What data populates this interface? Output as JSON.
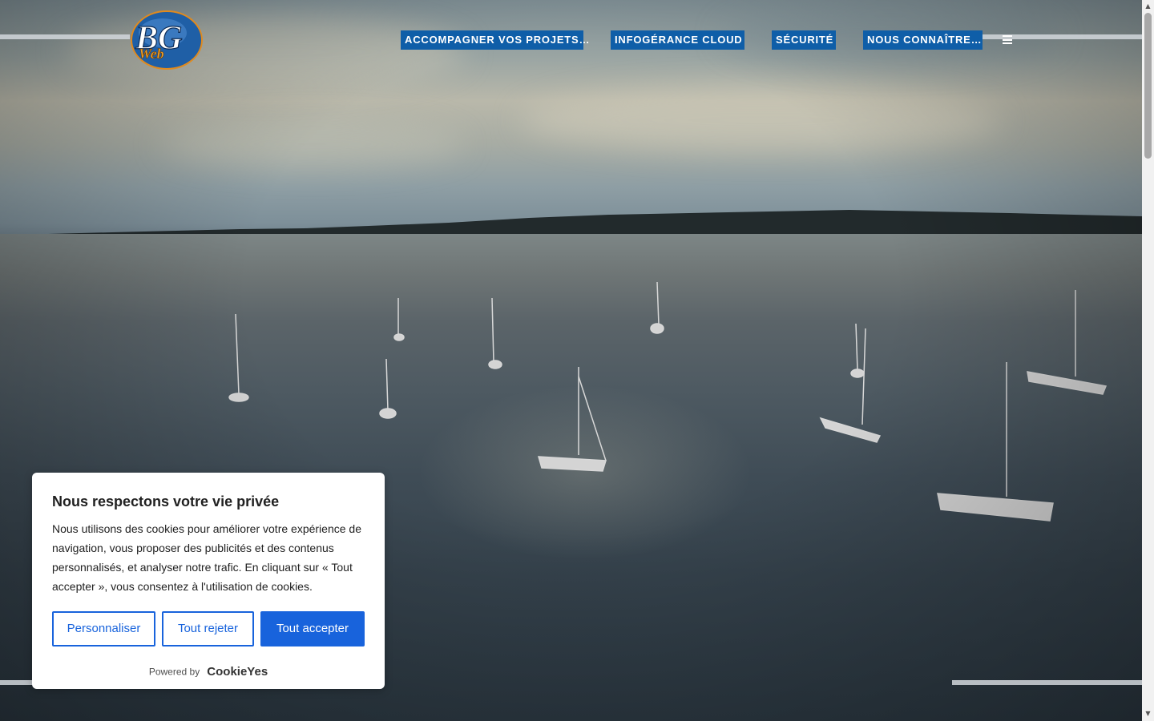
{
  "logo": {
    "line1": "BG",
    "line2": "Web"
  },
  "nav": {
    "items": [
      {
        "label": "ACCOMPAGNER VOS PROJETS…"
      },
      {
        "label": "INFOGÉRANCE CLOUD"
      },
      {
        "label": "SÉCURITÉ"
      },
      {
        "label": "NOUS CONNAÎTRE…"
      }
    ],
    "menu_icon": "hamburger-icon"
  },
  "hero": {
    "image": "aerial view of sailboats anchored on a lake at dusk"
  },
  "cookie_banner": {
    "title": "Nous respectons votre vie privée",
    "text": "Nous utilisons des cookies pour améliorer votre expérience de navigation, vous proposer des publicités et des contenus personnalisés, et analyser notre trafic. En cliquant sur « Tout accepter », vous consentez à l'utilisation de cookies.",
    "buttons": {
      "customize": "Personnaliser",
      "reject": "Tout rejeter",
      "accept": "Tout accepter"
    },
    "powered_by": "Powered by",
    "brand": "CookieYes"
  },
  "colors": {
    "nav_bg": "#0f5ea8",
    "cookie_accent": "#1863dc"
  }
}
